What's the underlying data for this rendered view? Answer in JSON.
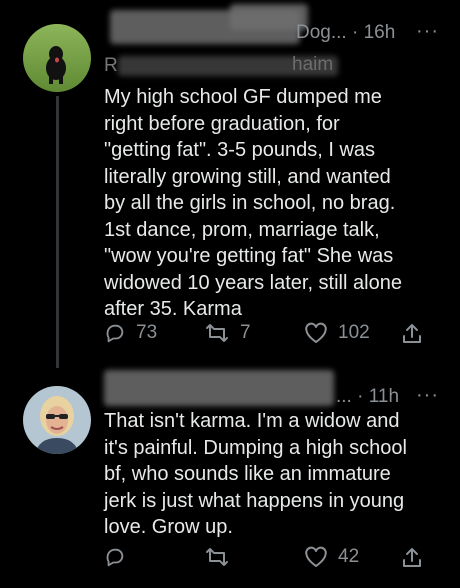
{
  "tweets": [
    {
      "handle_suffix": "Dog...",
      "separator": "·",
      "time": "16h",
      "more": "···",
      "reply_line_fragment_1": "R",
      "reply_line_fragment_2": "haim",
      "body": "My high school GF dumped me\nright before graduation, for\n\"getting fat\". 3-5 pounds, I was\nliterally growing still, and wanted\nby all the girls in school, no brag.\n1st dance, prom, marriage talk,\n\"wow you're getting fat\" She was\nwidowed 10 years later, still alone\nafter 35. Karma",
      "replies": "73",
      "retweets": "7",
      "likes": "102"
    },
    {
      "handle_suffix": "...",
      "separator": "·",
      "time": "11h",
      "more": "···",
      "body": "That isn't karma. I'm a widow and\nit's painful. Dumping a high school\nbf, who sounds like an immature\njerk is just what happens in young\nlove. Grow up.",
      "replies": "",
      "retweets": "",
      "likes": "42"
    }
  ],
  "icons": {
    "reply": "reply-icon",
    "retweet": "retweet-icon",
    "like": "heart-icon",
    "share": "share-icon",
    "more": "more-icon"
  },
  "colors": {
    "background": "#000000",
    "text": "#e7e9ea",
    "muted": "#8b9095",
    "thread_line": "#333639"
  }
}
